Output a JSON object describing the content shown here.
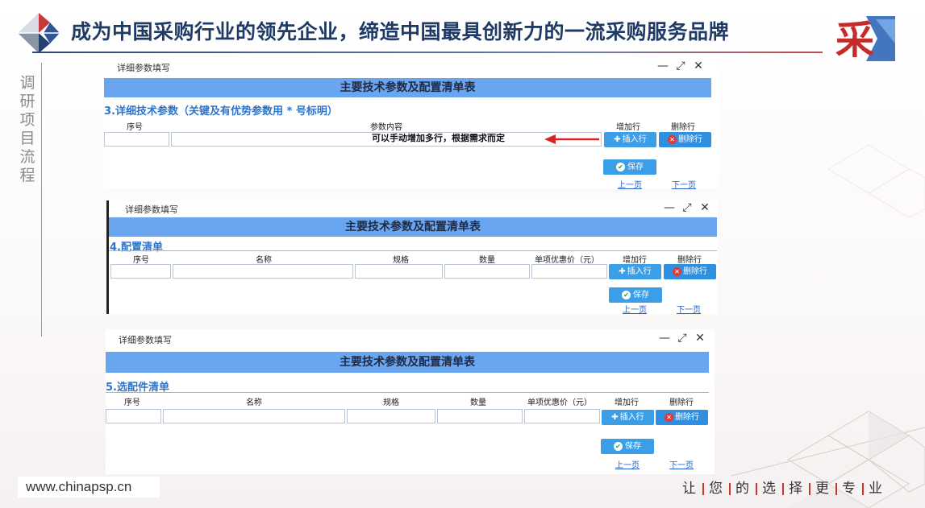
{
  "header": {
    "title": "成为中国采购行业的领先企业，缔造中国最具创新力的一流采购服务品牌",
    "logo_right_glyph": "采",
    "colors": {
      "title": "#1f3a64",
      "accent_red": "#c33333",
      "bar_blue": "#6aa6f0"
    }
  },
  "side": {
    "chars": [
      "调",
      "研",
      "项",
      "目",
      "流",
      "程"
    ]
  },
  "footer": {
    "url": "www.chinapsp.cn",
    "slogan": [
      "让",
      "您",
      "的",
      "选",
      "择",
      "更",
      "专",
      "业"
    ]
  },
  "window_controls": {
    "minimize": "—",
    "maximize": "⤢",
    "close": "✕"
  },
  "panels": [
    {
      "header": "详细参数填写",
      "bar_title": "主要技术参数及配置清单表",
      "section_title": "3.详细技术参数（关键及有优势参数用 * 号标明）",
      "columns": [
        "序号",
        "参数内容",
        "增加行",
        "删除行"
      ],
      "annotation": "可以手动增加多行，根据需求而定",
      "insert_label": "插入行",
      "delete_label": "删除行",
      "save_label": "保存",
      "prev_label": "上一页",
      "next_label": "下一页"
    },
    {
      "header": "详细参数填写",
      "bar_title": "主要技术参数及配置清单表",
      "section_title": "4.配置清单",
      "columns": [
        "序号",
        "名称",
        "规格",
        "数量",
        "单项优惠价（元）",
        "增加行",
        "删除行"
      ],
      "insert_label": "插入行",
      "delete_label": "删除行",
      "save_label": "保存",
      "prev_label": "上一页",
      "next_label": "下一页"
    },
    {
      "header": "详细参数填写",
      "bar_title": "主要技术参数及配置清单表",
      "section_title": "5.选配件清单",
      "columns": [
        "序号",
        "名称",
        "规格",
        "数量",
        "单项优惠价（元）",
        "增加行",
        "删除行"
      ],
      "insert_label": "插入行",
      "delete_label": "删除行",
      "save_label": "保存",
      "prev_label": "上一页",
      "next_label": "下一页"
    }
  ]
}
